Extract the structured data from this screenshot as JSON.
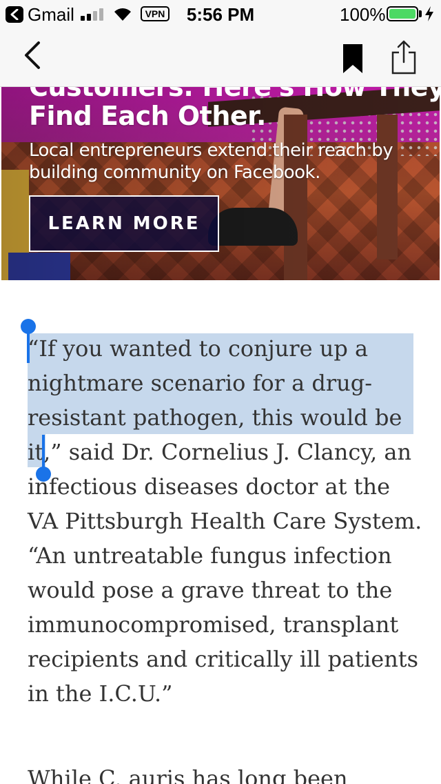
{
  "status_bar": {
    "app_label": "Gmail",
    "vpn_label": "VPN",
    "time": "5:56 PM",
    "battery_percent": "100%",
    "battery_level": 1.0,
    "battery_color": "#4cd964"
  },
  "nav": {
    "back_icon": "chevron-left-icon",
    "bookmark_icon": "bookmark-icon",
    "share_icon": "share-icon"
  },
  "ad": {
    "headline_cut": "Customers: Here's How They",
    "headline": "Find Each Other.",
    "subtext": "Local entrepreneurs extend their reach by building community on Facebook.",
    "cta_label": "LEARN MORE"
  },
  "article": {
    "paragraph1_selected": "“If you wanted to conjure up a nightmare scenario for a drug-resistant pathogen, this would be it,",
    "paragraph1_rest": "” said Dr. Cornelius J. Clancy, an infectious diseases doctor at the VA Pittsburgh Health Care System. “An untreatable fungus infection would pose a grave threat to the immunocompromised, transplant recipients and critically ill patients in the I.C.U.”",
    "paragraph2_start": "While C. auris has long been",
    "selection_color": "#c6d8ec",
    "handle_color": "#1a73e8"
  }
}
